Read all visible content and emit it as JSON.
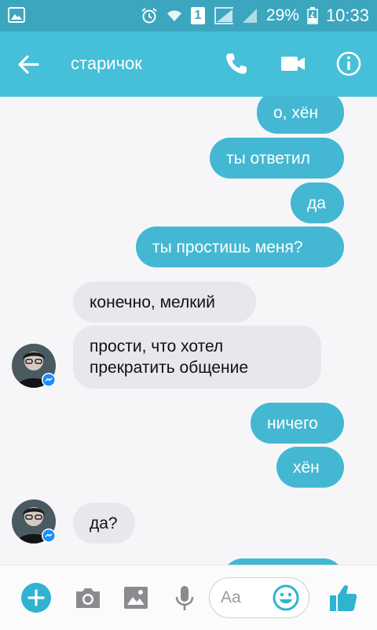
{
  "status_bar": {
    "sim_badge": "1",
    "battery": "29%",
    "time": "10:33"
  },
  "header": {
    "contact_name": "старичок"
  },
  "messages": [
    {
      "text": "о, хён",
      "from": "me"
    },
    {
      "text": "ты ответил",
      "from": "me"
    },
    {
      "text": "да",
      "from": "me"
    },
    {
      "text": "ты простишь меня?",
      "from": "me"
    },
    {
      "text": "конечно, мелкий",
      "from": "them"
    },
    {
      "text": "прости, что хотел",
      "from": "them"
    },
    {
      "text": "прекратить общение",
      "from": "them"
    },
    {
      "text": "ничего",
      "from": "me"
    },
    {
      "text": "хён",
      "from": "me"
    },
    {
      "text": "да?",
      "from": "them"
    }
  ],
  "composer": {
    "placeholder": "Aa"
  },
  "colors": {
    "header": "#46bfd8",
    "status_bar": "#3ca6bf",
    "outgoing_bubble": "#44b8d2",
    "incoming_bubble": "#e7e7ec",
    "accent": "#2fb3d0"
  },
  "icons": [
    "gallery-icon",
    "alarm-icon",
    "wifi-icon",
    "signal-icon",
    "battery-icon",
    "back-arrow-icon",
    "phone-icon",
    "video-call-icon",
    "info-icon",
    "messenger-badge-icon",
    "add-icon",
    "camera-icon",
    "image-icon",
    "microphone-icon",
    "emoji-icon",
    "thumbs-up-icon"
  ]
}
